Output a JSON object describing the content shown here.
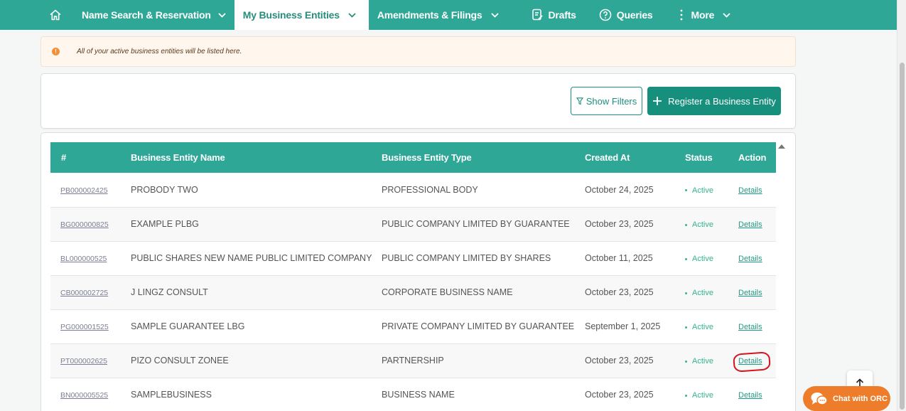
{
  "nav": {
    "home_icon": "home-icon",
    "items": [
      {
        "label": "Name Search & Reservation",
        "has_dropdown": true,
        "active": false
      },
      {
        "label": "My Business Entities",
        "has_dropdown": true,
        "active": true
      },
      {
        "label": "Amendments & Filings",
        "has_dropdown": true,
        "active": false
      },
      {
        "label": "Drafts",
        "icon": "document-edit-icon",
        "active": false
      },
      {
        "label": "Queries",
        "icon": "question-circle-icon",
        "active": false
      },
      {
        "label": "More",
        "icon": "vertical-dots-icon",
        "has_dropdown": true,
        "active": false
      }
    ],
    "accent_color": "#2ea796"
  },
  "banner": {
    "text": "All of your active business entities will be listed here.",
    "icon": "alert-circle-icon",
    "color": "#f0913a"
  },
  "actions": {
    "show_filters_label": "Show Filters",
    "register_label": "Register a Business Entity"
  },
  "table": {
    "headers": [
      "#",
      "Business Entity Name",
      "Business Entity Type",
      "Created At",
      "Status",
      "Action"
    ],
    "rows": [
      {
        "id": "PB000002425",
        "name": "PROBODY TWO",
        "type": "PROFESSIONAL BODY",
        "created": "October 24, 2025",
        "status": "Active",
        "action": "Details"
      },
      {
        "id": "BG000000825",
        "name": "EXAMPLE PLBG",
        "type": "PUBLIC COMPANY LIMITED BY GUARANTEE",
        "created": "October 23, 2025",
        "status": "Active",
        "action": "Details"
      },
      {
        "id": "BL000000525",
        "name": "PUBLIC SHARES NEW NAME PUBLIC LIMITED COMPANY",
        "type": "PUBLIC COMPANY LIMITED BY SHARES",
        "created": "October 11, 2025",
        "status": "Active",
        "action": "Details"
      },
      {
        "id": "CB000002725",
        "name": "J LINGZ CONSULT",
        "type": "CORPORATE BUSINESS NAME",
        "created": "October 23, 2025",
        "status": "Active",
        "action": "Details"
      },
      {
        "id": "PG000001525",
        "name": "SAMPLE GUARANTEE LBG",
        "type": "PRIVATE COMPANY LIMITED BY GUARANTEE",
        "created": "September 1, 2025",
        "status": "Active",
        "action": "Details"
      },
      {
        "id": "PT000002625",
        "name": "PIZO CONSULT ZONEE",
        "type": "PARTNERSHIP",
        "created": "October 23, 2025",
        "status": "Active",
        "action": "Details",
        "highlighted": true
      },
      {
        "id": "BN000005525",
        "name": "SAMPLEBUSINESS",
        "type": "BUSINESS NAME",
        "created": "October 23, 2025",
        "status": "Active",
        "action": "Details"
      }
    ]
  },
  "floating": {
    "scroll_top_icon": "arrow-up-icon",
    "chat_label": "Chat with ORC",
    "chat_icon": "chat-bubbles-icon",
    "chat_color": "#ee7d2b"
  }
}
